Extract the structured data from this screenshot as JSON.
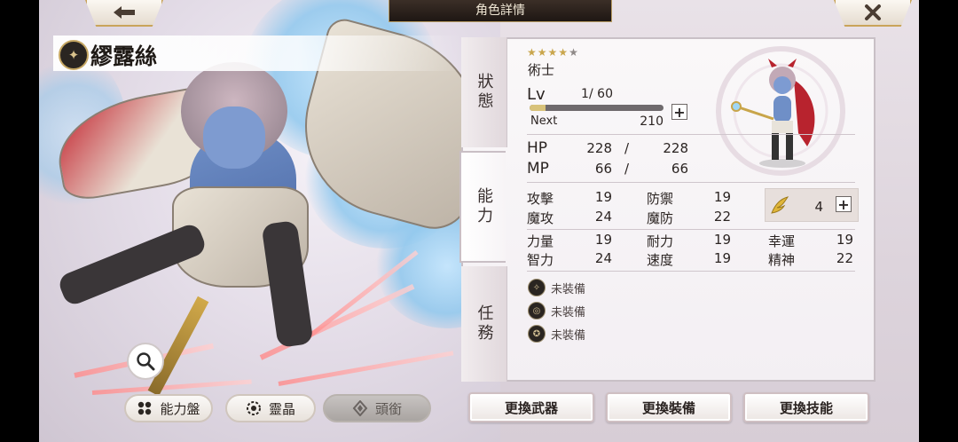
{
  "header": {
    "title": "角色詳情",
    "back_icon": "arrow-left-icon",
    "close_icon": "close-icon"
  },
  "character": {
    "name": "繆露絲",
    "class": "術士",
    "stars_total": 5,
    "stars_filled": 4,
    "level_label": "Lv",
    "level": "1",
    "level_max": "/ 60",
    "next_label": "Next",
    "next_value": "210",
    "exp_progress": 0.12
  },
  "stats": {
    "hp": {
      "label": "HP",
      "cur": "228",
      "sep": "/",
      "max": "228"
    },
    "mp": {
      "label": "MP",
      "cur": "66",
      "sep": "/",
      "max": "66"
    },
    "attack": {
      "label": "攻擊",
      "value": "19"
    },
    "defense": {
      "label": "防禦",
      "value": "19"
    },
    "magic_attack": {
      "label": "魔攻",
      "value": "24"
    },
    "magic_defense": {
      "label": "魔防",
      "value": "22"
    },
    "strength": {
      "label": "力量",
      "value": "19"
    },
    "endurance": {
      "label": "耐力",
      "value": "19"
    },
    "luck": {
      "label": "幸運",
      "value": "19"
    },
    "intellect": {
      "label": "智力",
      "value": "24"
    },
    "speed": {
      "label": "速度",
      "value": "19"
    },
    "spirit": {
      "label": "精神",
      "value": "22"
    },
    "bonus_points": "4"
  },
  "tabs": {
    "status": "狀態",
    "ability": "能力",
    "mission": "任務"
  },
  "equipment": [
    {
      "label": "未裝備",
      "icon": "weapon-slot-icon"
    },
    {
      "label": "未裝備",
      "icon": "accessory-slot-icon"
    },
    {
      "label": "未裝備",
      "icon": "emblem-slot-icon"
    }
  ],
  "bottom_left": {
    "ability_board": "能力盤",
    "spirit_crystal": "靈晶",
    "title": "頭銜"
  },
  "actions": {
    "change_weapon": "更換武器",
    "change_equipment": "更換裝備",
    "change_skill": "更換技能"
  },
  "colors": {
    "gold_accent": "#c9a45a",
    "panel_bg": "#f7f4f6",
    "exp_fill": "#d8c27a"
  }
}
